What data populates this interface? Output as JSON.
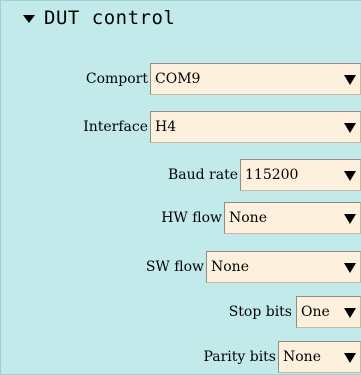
{
  "section": {
    "title": "DUT control"
  },
  "fields": {
    "comport": {
      "label": "Comport",
      "value": "COM9"
    },
    "interface": {
      "label": "Interface",
      "value": "H4"
    },
    "baud_rate": {
      "label": "Baud rate",
      "value": "115200"
    },
    "hw_flow": {
      "label": "HW flow",
      "value": "None"
    },
    "sw_flow": {
      "label": "SW flow",
      "value": "None"
    },
    "stop_bits": {
      "label": "Stop bits",
      "value": "One"
    },
    "parity_bits": {
      "label": "Parity bits",
      "value": "None"
    }
  },
  "icons": {
    "section_toggle": "triangle-down-icon",
    "dropdown": "triangle-down-icon"
  },
  "colors": {
    "panel_bg": "#c2eaeb",
    "field_bg": "#fdf0dc"
  }
}
